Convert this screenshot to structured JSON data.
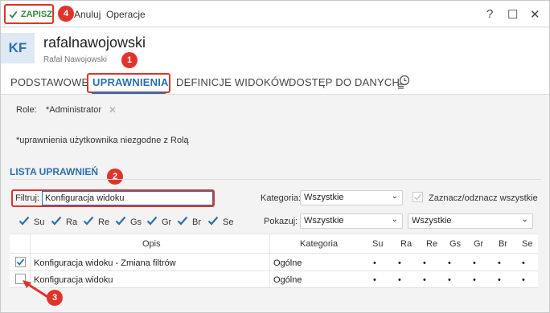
{
  "toolbar": {
    "save_label": "ZAPISZ",
    "cancel_label": "Anuluj",
    "operations_label": "Operacje",
    "help": "?",
    "maximize": "☐",
    "close": "✕"
  },
  "badges": [
    "4",
    "1",
    "2",
    "3"
  ],
  "header": {
    "avatar": "KF",
    "login": "rafalnawojowski",
    "full_name": "Rafał Nawojowski"
  },
  "tabs": [
    {
      "label": "PODSTAWOWE"
    },
    {
      "label": "UPRAWNIENIA"
    },
    {
      "label": "DEFINICJE WIDOKÓW"
    },
    {
      "label": "DOSTĘP DO DANYCH"
    }
  ],
  "role": {
    "label": "Role:",
    "value": "*Administrator",
    "remove": "✕"
  },
  "notice": "*uprawnienia użytkownika niezgodne z Rolą",
  "section_title": "LISTA UPRAWNIEŃ",
  "filter": {
    "label": "Filtruj:",
    "value": "Konfiguracja widoku"
  },
  "category": {
    "label": "Kategoria:",
    "value": "Wszystkie"
  },
  "toggle_all_label": "Zaznacz/odznacz wszystkie",
  "show": {
    "label": "Pokazuj:",
    "value1": "Wszystkie",
    "value2": "Wszystkie"
  },
  "flags": [
    {
      "label": "Su",
      "checked": true
    },
    {
      "label": "Ra",
      "checked": true
    },
    {
      "label": "Re",
      "checked": true
    },
    {
      "label": "Gs",
      "checked": true
    },
    {
      "label": "Gr",
      "checked": true
    },
    {
      "label": "Br",
      "checked": true
    },
    {
      "label": "Se",
      "checked": true
    }
  ],
  "table": {
    "headers": [
      "Opis",
      "Kategoria",
      "Su",
      "Ra",
      "Re",
      "Gs",
      "Gr",
      "Br",
      "Se"
    ],
    "rows": [
      {
        "checked": true,
        "opis": "Konfiguracja widoku - Zmiana filtrów",
        "kategoria": "Ogólne",
        "marks": [
          "•",
          "•",
          "•",
          "•",
          "•",
          "•",
          "•"
        ]
      },
      {
        "checked": false,
        "opis": "Konfiguracja widoku",
        "kategoria": "Ogólne",
        "marks": [
          "•",
          "•",
          "•",
          "•",
          "•",
          "•",
          "•"
        ]
      }
    ]
  },
  "colors": {
    "accent": "#2b6fb3",
    "highlight": "#d9362b",
    "save_green": "#2e8b3a"
  }
}
